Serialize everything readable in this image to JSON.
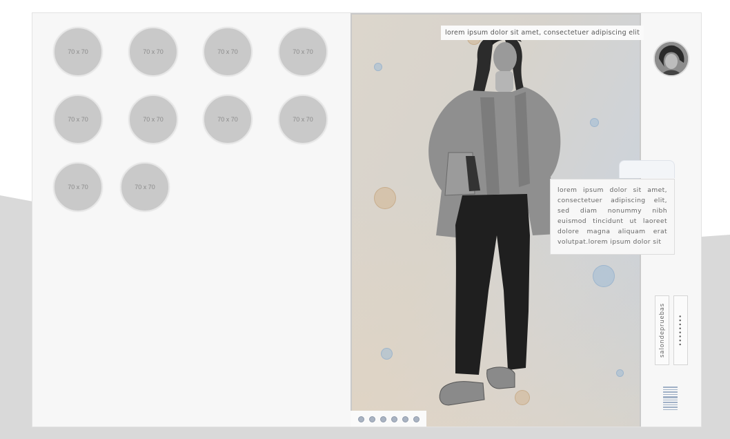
{
  "avatars": [
    {
      "label": "70 x 70"
    },
    {
      "label": "70 x 70"
    },
    {
      "label": "70 x 70"
    },
    {
      "label": "70 x 70"
    },
    {
      "label": "70 x 70"
    },
    {
      "label": "70 x 70"
    },
    {
      "label": "70 x 70"
    },
    {
      "label": "70 x 70"
    },
    {
      "label": "70 x 70"
    },
    {
      "label": "70 x 70"
    }
  ],
  "hero": {
    "caption": "lorem ipsum dolor sit amet, consectetuer adipiscing elit",
    "slides": 6
  },
  "sidebar": {
    "description": "lorem ipsum dolor sit amet, consectetuer adipiscing elit, sed diam nonummy nibh euismod tincidunt ut laoreet dolore magna aliquam erat volutpat.lorem ipsum dolor sit",
    "username": "salondepruebas",
    "password": "••••••••"
  },
  "colors": {
    "accent_blue": "#a9b3c2",
    "placeholder_gray": "#c9c9c9"
  }
}
